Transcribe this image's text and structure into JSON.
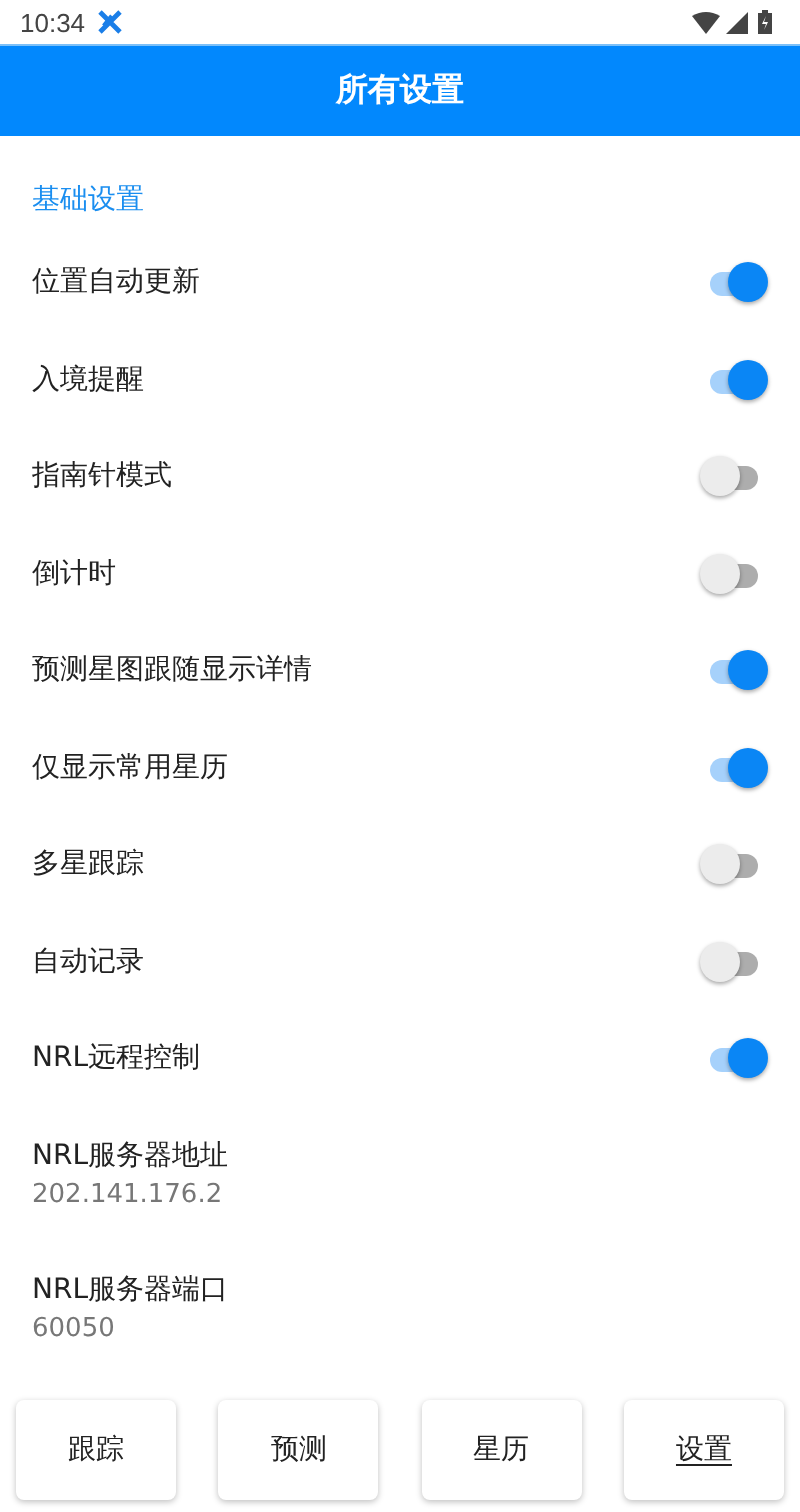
{
  "status_bar": {
    "time": "10:34"
  },
  "app_bar": {
    "title": "所有设置"
  },
  "section": {
    "title": "基础设置"
  },
  "settings": [
    {
      "kind": "toggle",
      "label": "位置自动更新",
      "on": true
    },
    {
      "kind": "toggle",
      "label": "入境提醒",
      "on": true
    },
    {
      "kind": "toggle",
      "label": "指南针模式",
      "on": false
    },
    {
      "kind": "toggle",
      "label": "倒计时",
      "on": false
    },
    {
      "kind": "toggle",
      "label": "预测星图跟随显示详情",
      "on": true
    },
    {
      "kind": "toggle",
      "label": "仅显示常用星历",
      "on": true
    },
    {
      "kind": "toggle",
      "label": "多星跟踪",
      "on": false
    },
    {
      "kind": "toggle",
      "label": "自动记录",
      "on": false
    },
    {
      "kind": "toggle",
      "label": "NRL远程控制",
      "on": true
    },
    {
      "kind": "value",
      "label": "NRL服务器地址",
      "value": "202.141.176.2"
    },
    {
      "kind": "value",
      "label": "NRL服务器端口",
      "value": "60050"
    }
  ],
  "bottom_nav": [
    {
      "label": "跟踪",
      "selected": false
    },
    {
      "label": "预测",
      "selected": false
    },
    {
      "label": "星历",
      "selected": false
    },
    {
      "label": "设置",
      "selected": true
    }
  ]
}
